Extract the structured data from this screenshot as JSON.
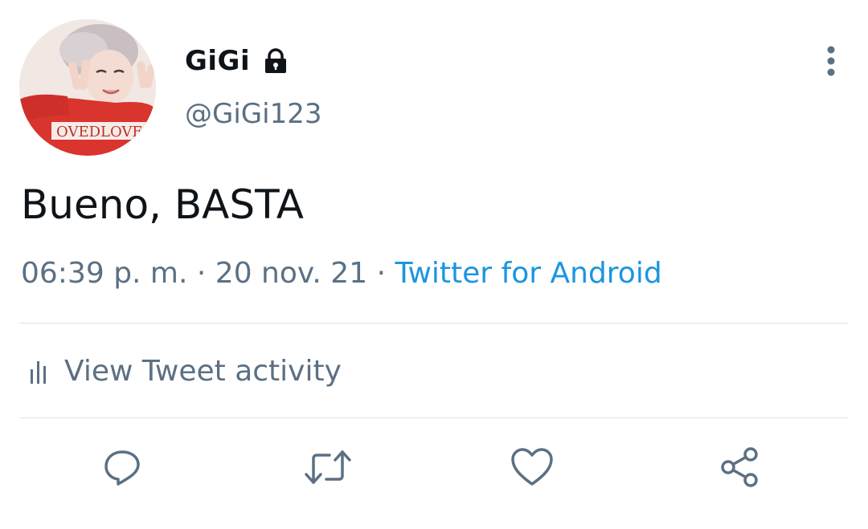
{
  "tweet": {
    "author": {
      "display_name": "GiGi",
      "handle": "@GiGi123",
      "avatar_icon": "avatar-photo",
      "protected_icon": "lock-icon"
    },
    "text": "Bueno, BASTA",
    "time": "06:39 p. m.",
    "separator": "·",
    "date": "20 nov. 21",
    "source": "Twitter for Android",
    "activity_label": "View Tweet activity",
    "menu_icon": "more-vertical-icon"
  },
  "actions": [
    {
      "name": "reply",
      "icon": "reply-icon"
    },
    {
      "name": "retweet",
      "icon": "retweet-icon"
    },
    {
      "name": "like",
      "icon": "heart-icon"
    },
    {
      "name": "share",
      "icon": "share-icon"
    }
  ],
  "colors": {
    "text_primary": "#0f1419",
    "text_secondary": "#5b7083",
    "link": "#1b95e0",
    "divider": "#dfe3e6",
    "icon": "#5b7083"
  }
}
